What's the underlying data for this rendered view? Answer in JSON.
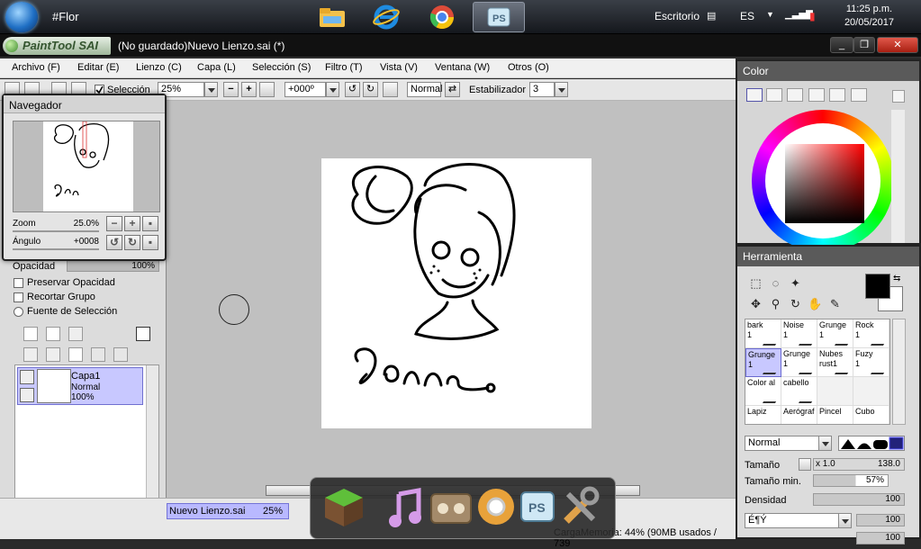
{
  "taskbar": {
    "window_title": "#Flor",
    "desktop_label": "Escritorio",
    "language": "ES",
    "time": "11:25 p.m.",
    "date": "20/05/2017",
    "pinned_apps": [
      "file-explorer",
      "internet-explorer",
      "chrome",
      "paint-tool-sai"
    ]
  },
  "titlebar": {
    "app_logo_text": "PaintTool SAI",
    "document_title": "(No guardado)Nuevo Lienzo.sai (*)",
    "minimize": "_",
    "maximize": "❐",
    "close": "✕"
  },
  "menu": [
    {
      "label": "Archivo (F)"
    },
    {
      "label": "Editar (E)"
    },
    {
      "label": "Lienzo (C)"
    },
    {
      "label": "Capa (L)"
    },
    {
      "label": "Selección (S)"
    },
    {
      "label": "Filtro (T)"
    },
    {
      "label": "Vista (V)"
    },
    {
      "label": "Ventana (W)"
    },
    {
      "label": "Otros (O)"
    }
  ],
  "toolbar": {
    "selection_label": "Selección",
    "zoom_value": "25%",
    "rotation_value": "+000º",
    "blend_mode": "Normal",
    "stabilizer_label": "Estabilizador",
    "stabilizer_value": "3"
  },
  "navigator": {
    "title": "Navegador",
    "zoom_label": "Zoom",
    "zoom_value": "25.0%",
    "angle_label": "Ángulo",
    "angle_value": "+0008"
  },
  "layers_panel": {
    "opacity_label": "Opacidad",
    "opacity_value": "100%",
    "preserve_opacity": "Preservar Opacidad",
    "clip_group": "Recortar Grupo",
    "selection_source": "Fuente de Selección",
    "layer": {
      "name": "Capa1",
      "mode": "Normal",
      "opacity": "100%"
    }
  },
  "color_panel": {
    "title": "Color",
    "selected_color": "#000000"
  },
  "tool_panel": {
    "title": "Herramienta",
    "brushes": [
      {
        "name": "bark",
        "size": "1"
      },
      {
        "name": "Noise",
        "size": "1"
      },
      {
        "name": "Grunge",
        "size": "1"
      },
      {
        "name": "Rock",
        "size": "1"
      },
      {
        "name": "Grunge",
        "size": "1"
      },
      {
        "name": "Grunge",
        "size": "1"
      },
      {
        "name": "Nubes",
        "size": "rust1"
      },
      {
        "name": "Fuzy",
        "size": "1"
      },
      {
        "name": "Color al",
        "size": ""
      },
      {
        "name": "cabello",
        "size": ""
      },
      {
        "name": "",
        "size": ""
      },
      {
        "name": "",
        "size": ""
      },
      {
        "name": "Lapiz",
        "size": ""
      },
      {
        "name": "Aerógraf",
        "size": ""
      },
      {
        "name": "Pincel",
        "size": ""
      },
      {
        "name": "Cubo",
        "size": ""
      }
    ],
    "blend_mode": "Normal",
    "size_label": "Tamaño",
    "size_multiplier": "x 1.0",
    "size_value": "138.0",
    "min_size_label": "Tamaño min.",
    "min_size_value": "57%",
    "density_label": "Densidad",
    "density_value": "100",
    "texture_value": "É¶Ý",
    "texture_amount": "100",
    "extra_amount": "100"
  },
  "statusbar": {
    "document_tab": "Nuevo Lienzo.sai",
    "document_zoom": "25%",
    "memory_text": "CargaMemoria: 44% (90MB usados / 739"
  },
  "dock": {
    "apps": [
      "minecraft",
      "music",
      "video",
      "chrome",
      "paint-tool-sai",
      "tools"
    ]
  }
}
